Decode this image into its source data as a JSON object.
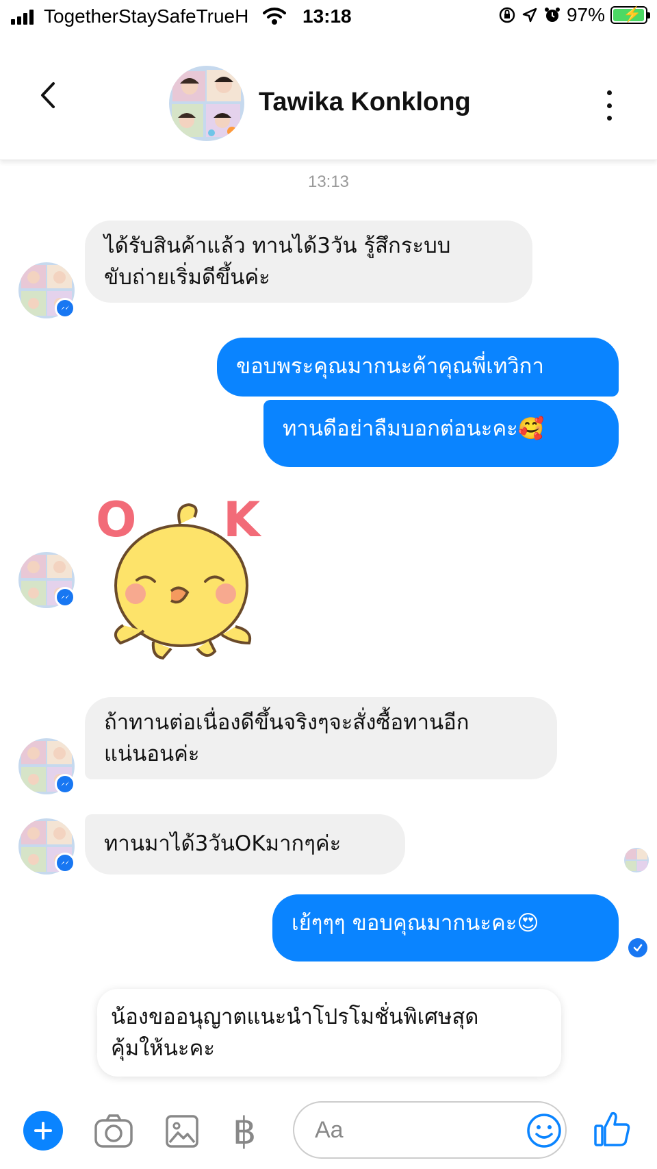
{
  "status_bar": {
    "carrier": "TogetherStaySafeTrueH",
    "time": "13:18",
    "battery": "97%",
    "battery_level": 0.97
  },
  "header": {
    "contact_name": "Tawika Konklong"
  },
  "conversation": {
    "timestamp": "13:13",
    "messages": [
      {
        "from": "contact",
        "lines": [
          "ได้รับสินค้าแล้ว ทานได้3วัน รู้สึกระบบ",
          "ขับถ่ายเริ่มดีขึ้นค่ะ"
        ]
      },
      {
        "from": "me",
        "text": "ขอบพระคุณมากนะค้าคุณพี่เทวิกา"
      },
      {
        "from": "me",
        "text": "ทานดีอย่าลืมบอกต่อนะคะ🥰"
      },
      {
        "from": "contact",
        "type": "sticker",
        "sticker_text_left": "O",
        "sticker_text_right": "K"
      },
      {
        "from": "contact",
        "lines": [
          "ถ้าทานต่อเนื่องดีขึ้นจริงๆจะสั่งซื้อทานอีก",
          "แน่นอนค่ะ"
        ]
      },
      {
        "from": "contact",
        "text": "ทานมาได้3วันOKมากๆค่ะ"
      },
      {
        "from": "me",
        "text": "เย้ๆๆๆ ขอบคุณมากนะคะ😍"
      },
      {
        "from": "me",
        "type": "draft_popup",
        "lines": [
          "น้องขออนุญาตแนะนำโปรโมชั่นพิเศษสุด",
          "คุ้มให้นะคะ"
        ]
      }
    ]
  },
  "composer": {
    "placeholder": "Aa",
    "currency_symbol": "฿"
  },
  "colors": {
    "outgoing_bubble": "#0a84ff",
    "incoming_bubble": "#f0f0f0",
    "messenger_blue": "#1877f2"
  },
  "icons": {
    "back": "chevron-left-icon",
    "more": "more-vertical-icon",
    "plus": "plus-icon",
    "camera": "camera-icon",
    "gallery": "image-icon",
    "currency": "baht-icon",
    "emoji": "smiley-icon",
    "like": "thumbs-up-icon"
  }
}
